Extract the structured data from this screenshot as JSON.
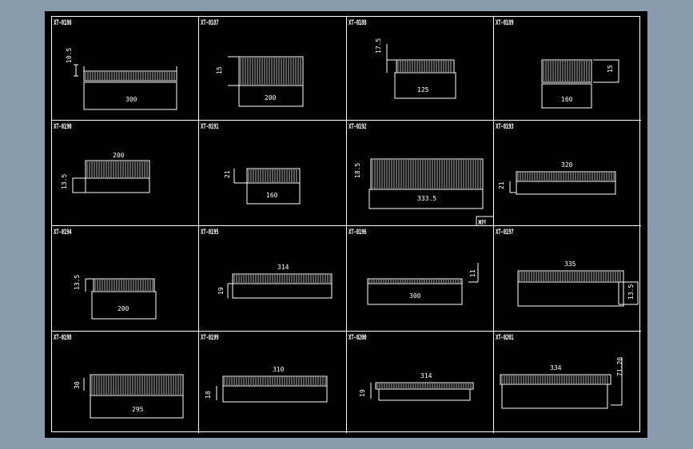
{
  "drawing": {
    "background": "#8b9bae",
    "sheet_color": "#000000",
    "line_color": "#ffffff",
    "corner_mark": "ЖМ"
  },
  "cells": [
    {
      "code": "XT-0186",
      "height_dim": "10.5",
      "width_dim": "300"
    },
    {
      "code": "XT-0187",
      "height_dim": "15",
      "width_dim": "200"
    },
    {
      "code": "XT-0188",
      "height_dim": "17.5",
      "width_dim": "125"
    },
    {
      "code": "XT-0189",
      "height_dim": "15",
      "width_dim": "160"
    },
    {
      "code": "XT-0190",
      "height_dim": "13.5",
      "width_dim": "200"
    },
    {
      "code": "XT-0191",
      "height_dim": "21",
      "width_dim": "160"
    },
    {
      "code": "XT-0192",
      "height_dim": "18.5",
      "width_dim": "333.5"
    },
    {
      "code": "XT-0193",
      "height_dim": "21",
      "width_dim": "320"
    },
    {
      "code": "XT-0194",
      "height_dim": "13.5",
      "width_dim": "200"
    },
    {
      "code": "XT-0195",
      "height_dim": "19",
      "width_dim": "314"
    },
    {
      "code": "XT-0196",
      "height_dim": "11",
      "width_dim": "300"
    },
    {
      "code": "XT-0197",
      "height_dim": "13.5",
      "width_dim": "335"
    },
    {
      "code": "XT-0198",
      "height_dim": "30",
      "width_dim": "295"
    },
    {
      "code": "XT-0199",
      "height_dim": "18",
      "width_dim": "310"
    },
    {
      "code": "XT-0200",
      "height_dim": "19",
      "width_dim": "314"
    },
    {
      "code": "XT-0201",
      "height_dim": "71.20",
      "width_dim": "334"
    }
  ]
}
